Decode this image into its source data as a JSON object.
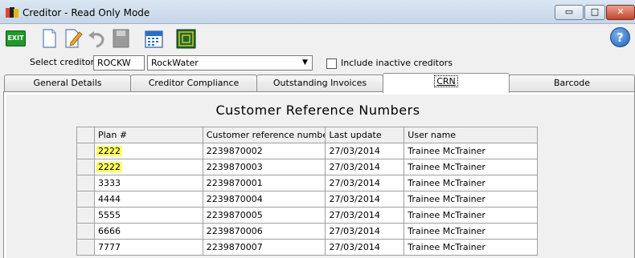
{
  "window": {
    "title": "Creditor - Read Only Mode",
    "minimize": "▭",
    "maximize": "□",
    "close": "✕"
  },
  "toolbar": {
    "exit_label": "EXIT",
    "help_label": "?"
  },
  "selector": {
    "label": "Select creditor",
    "code": "ROCKW",
    "name": "RockWater",
    "include_inactive_label": "Include inactive creditors",
    "include_inactive_checked": false
  },
  "tabs": [
    {
      "label": "General Details"
    },
    {
      "label": "Creditor Compliance"
    },
    {
      "label": "Outstanding Invoices"
    },
    {
      "label": "CRN"
    },
    {
      "label": "Barcode"
    }
  ],
  "panel": {
    "heading": "Customer Reference Numbers"
  },
  "table": {
    "headers": [
      "Plan #",
      "Customer reference number",
      "Last update",
      "User name"
    ],
    "rows": [
      {
        "plan": "2222",
        "crn": "2239870002",
        "updated": "27/03/2014",
        "user": "Trainee McTrainer",
        "highlight": true
      },
      {
        "plan": "2222",
        "crn": "2239870003",
        "updated": "27/03/2014",
        "user": "Trainee McTrainer",
        "highlight": true
      },
      {
        "plan": "3333",
        "crn": "2239870001",
        "updated": "27/03/2014",
        "user": "Trainee McTrainer",
        "highlight": false
      },
      {
        "plan": "4444",
        "crn": "2239870004",
        "updated": "27/03/2014",
        "user": "Trainee McTrainer",
        "highlight": false
      },
      {
        "plan": "5555",
        "crn": "2239870005",
        "updated": "27/03/2014",
        "user": "Trainee McTrainer",
        "highlight": false
      },
      {
        "plan": "6666",
        "crn": "2239870006",
        "updated": "27/03/2014",
        "user": "Trainee McTrainer",
        "highlight": false
      },
      {
        "plan": "7777",
        "crn": "2239870007",
        "updated": "27/03/2014",
        "user": "Trainee McTrainer",
        "highlight": false
      }
    ]
  },
  "colors": {
    "highlight": "#ffff66",
    "exit_green": "#1e9a2c"
  }
}
